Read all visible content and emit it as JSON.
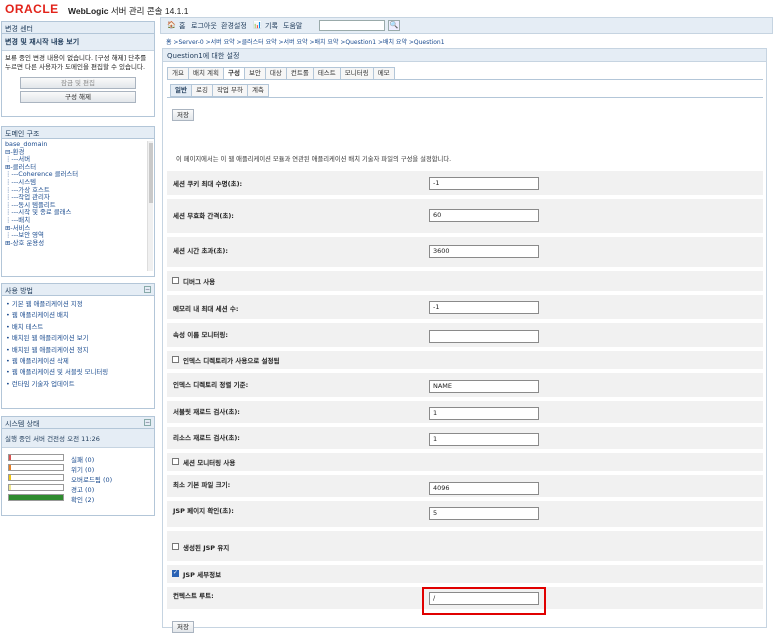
{
  "header": {
    "brand_oracle": "ORACLE",
    "brand_weblogic": "WebLogic",
    "brand_rest": "서버 관리 콘솔 14.1.1"
  },
  "change_center": {
    "title": "변경 센터",
    "subtitle": "변경 및 재시작 내용 보기",
    "text": "보류 중인 변경 내용이 없습니다. [구성 해제] 단추를 누르면 다른 사용자가 도메인을 편집할 수 있습니다.",
    "lock_button": "잠금 및 편집",
    "release_button": "구성 해제"
  },
  "domain_tree": {
    "title": "도메인 구조",
    "items": [
      "base_domain",
      "⊟-환경",
      "   ⋮---서버",
      "   ⊞-클러스터",
      "   ⋮---Coherence 클러스터",
      "   ⋮---시스템",
      "   ⋮---가상 호스트",
      "   ⋮---작업 관리자",
      "   ⋮---동시 템플리트",
      "   ⋮---시작 및 종료 클래스",
      "⋮---배치",
      "⊞-서비스",
      "⋮---보안 영역",
      "⊞-상호 운용성"
    ]
  },
  "how_do_i": {
    "title": "사용 방법",
    "items": [
      "기본 웹 애플리케이션 지정",
      "웹 애플리케이션 배치",
      "배치 테스트",
      "배치된 웹 애플리케이션 보기",
      "배치된 웹 애플리케이션 정지",
      "웹 애플리케이션 삭제",
      "웹 애플리케이션 및 서블릿 모니터링",
      "런타임 기술자 업데이트"
    ]
  },
  "system_status": {
    "title": "시스템 상태",
    "subtitle": "실행 중인 서버 건전성 오전 11:26",
    "rows": [
      {
        "label": "실패 (0)",
        "color": "#d9534f",
        "value": 0
      },
      {
        "label": "위기 (0)",
        "color": "#e67e22",
        "value": 0
      },
      {
        "label": "오버로드됨 (0)",
        "color": "#f1c40f",
        "value": 0
      },
      {
        "label": "경고 (0)",
        "color": "#f0e68c",
        "value": 0
      },
      {
        "label": "확인 (2)",
        "color": "#2e8b2e",
        "value": 2
      }
    ]
  },
  "toolbar": {
    "home": "홈",
    "logout": "로그아웃",
    "preferences": "환경설정",
    "record": "기록",
    "help": "도움말",
    "search_placeholder": ""
  },
  "breadcrumb": "홈 >Server-0 >서버 요약 >클러스터 요약 >서버 요약 >배치 요약 >Question1 >배치 요약 >Question1",
  "settings": {
    "title": "Question1에 대한 설정",
    "tabs": [
      "개요",
      "배치 계획",
      "구성",
      "보안",
      "대상",
      "컨트롤",
      "테스트",
      "모니터링",
      "메모"
    ],
    "active_tab": "구성",
    "subtabs": [
      "일반",
      "로깅",
      "작업 부하",
      "계측"
    ],
    "active_subtab": "일반",
    "save_label": "저장",
    "description": "이 페이지에서는 이 웹 애플리케이션 모듈과 연관된 애플리케이션 배치 기술자 파일의 구성을 설정합니다.",
    "fields": {
      "session_cookie_max_age": {
        "label": "세션 쿠키 최대 수명(초):",
        "value": "-1"
      },
      "session_invalidation_interval": {
        "label": "세션 무효화 간격(초):",
        "value": "60"
      },
      "session_timeout": {
        "label": "세션 시간 초과(초):",
        "value": "3600"
      },
      "debug": {
        "label": "디버그 사용",
        "checked": false
      },
      "max_sessions": {
        "label": "메모리 내 최대 세션 수:",
        "value": "-1"
      },
      "monitoring_attribute": {
        "label": "속성 이름 모니터링:",
        "value": ""
      },
      "index_directory": {
        "label": "인덱스 디렉토리가 사용으로 설정됨",
        "checked": false
      },
      "index_sort_by": {
        "label": "인덱스 디렉토리 정렬 기준:",
        "value": "NAME"
      },
      "servlet_reload_check": {
        "label": "서블릿 재로드 검사(초):",
        "value": "1"
      },
      "resource_reload_check": {
        "label": "리소스 재로드 검사(초):",
        "value": "1"
      },
      "session_monitoring": {
        "label": "세션 모니터링 사용",
        "checked": false
      },
      "min_native_file_size": {
        "label": "최소 기본 파일 크기:",
        "value": "4096"
      },
      "jsp_page_check": {
        "label": "JSP 페이지 확인(초):",
        "value": "5"
      },
      "keep_generated_jsp": {
        "label": "생성된 JSP 유지",
        "checked": false
      },
      "jsp_verbose": {
        "label": "JSP 세부정보",
        "checked": true
      },
      "context_root": {
        "label": "컨텍스트 루트:",
        "value": "/"
      }
    }
  }
}
